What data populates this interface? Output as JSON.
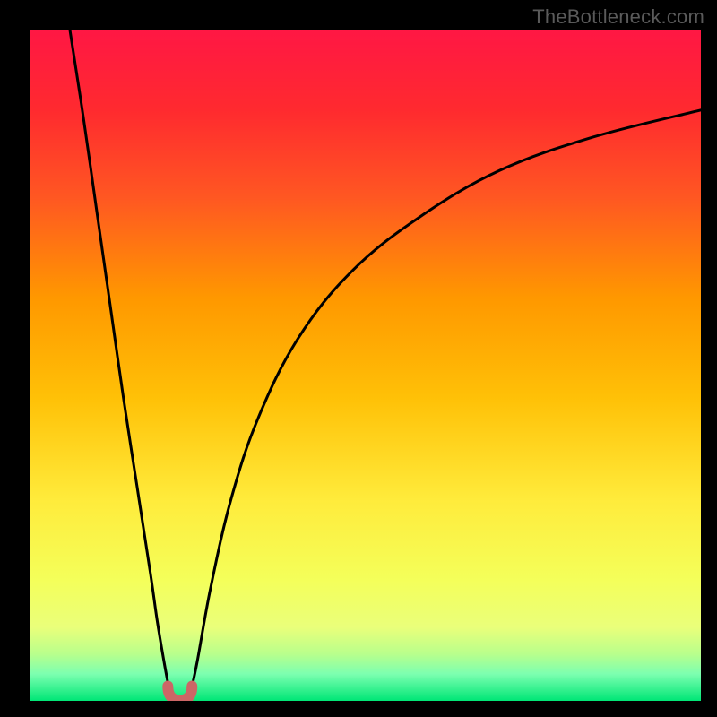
{
  "watermark": "TheBottleneck.com",
  "chart_data": {
    "type": "line",
    "title": "",
    "xlabel": "",
    "ylabel": "",
    "xlim": [
      0,
      100
    ],
    "ylim": [
      0,
      100
    ],
    "grid": false,
    "gradient_stops": [
      {
        "offset": 0,
        "color": "#ff1744"
      },
      {
        "offset": 12,
        "color": "#ff2a2f"
      },
      {
        "offset": 25,
        "color": "#ff5722"
      },
      {
        "offset": 40,
        "color": "#ff9800"
      },
      {
        "offset": 55,
        "color": "#ffc107"
      },
      {
        "offset": 70,
        "color": "#ffeb3b"
      },
      {
        "offset": 82,
        "color": "#f4ff5a"
      },
      {
        "offset": 89,
        "color": "#eaff7a"
      },
      {
        "offset": 93,
        "color": "#b9ff8c"
      },
      {
        "offset": 96,
        "color": "#7cffb0"
      },
      {
        "offset": 100,
        "color": "#00e676"
      }
    ],
    "series": [
      {
        "name": "bottleneck-curve-left",
        "stroke": "#000000",
        "x": [
          6,
          8,
          10,
          12,
          14,
          16,
          18,
          19,
          20,
          20.7
        ],
        "y": [
          100,
          87,
          73,
          59,
          45,
          32,
          19,
          12,
          6,
          2.2
        ]
      },
      {
        "name": "bottleneck-curve-right",
        "stroke": "#000000",
        "x": [
          24.2,
          25,
          27,
          30,
          34,
          40,
          48,
          58,
          70,
          84,
          100
        ],
        "y": [
          2.2,
          6,
          17,
          30,
          42,
          54,
          64,
          72,
          79,
          84,
          88
        ]
      },
      {
        "name": "bottleneck-minimum-marker",
        "stroke": "#cc6666",
        "type": "u-shape",
        "cx": 22.4,
        "width": 3.6,
        "y_top": 2.2,
        "y_bottom": 0.5
      }
    ]
  }
}
